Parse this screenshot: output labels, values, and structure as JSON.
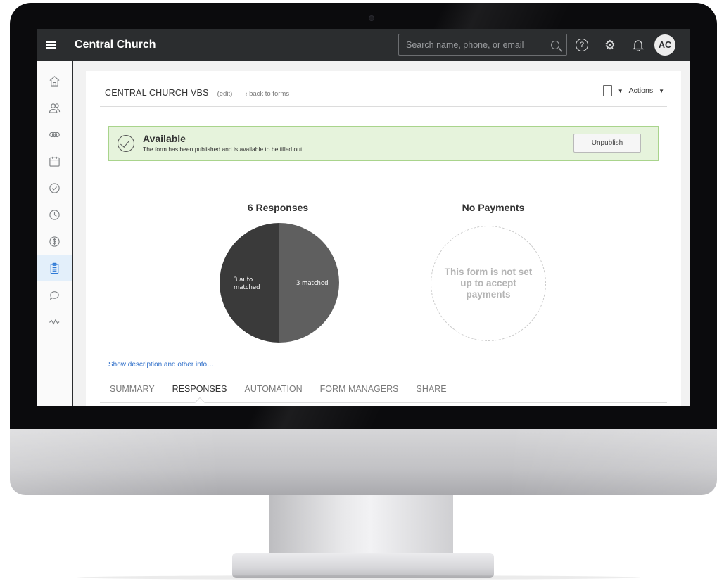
{
  "app": {
    "title": "Central Church"
  },
  "topbar": {
    "search_placeholder": "Search name, phone, or email",
    "avatar_initials": "AC"
  },
  "sidebar": {
    "items": [
      {
        "icon": "home-icon"
      },
      {
        "icon": "people-icon"
      },
      {
        "icon": "groups-icon"
      },
      {
        "icon": "calendar-icon"
      },
      {
        "icon": "check-circle-icon"
      },
      {
        "icon": "clock-icon"
      },
      {
        "icon": "dollar-icon"
      },
      {
        "icon": "clipboard-icon",
        "active": true
      },
      {
        "icon": "chat-icon"
      },
      {
        "icon": "activity-icon"
      }
    ]
  },
  "form_header": {
    "title": "CENTRAL CHURCH VBS",
    "edit_label": "(edit)",
    "back_label": "‹ back to forms",
    "actions_label": "Actions"
  },
  "status_banner": {
    "title": "Available",
    "subtitle": "The form has been published and is available to be filled out.",
    "button_label": "Unpublish"
  },
  "responses": {
    "title": "6 Responses",
    "slices": [
      {
        "label_line1": "3 auto",
        "label_line2": "matched",
        "value": 3,
        "color": "#3a3a3a"
      },
      {
        "label_line1": "3 matched",
        "label_line2": "",
        "value": 3,
        "color": "#5f5f5f"
      }
    ]
  },
  "payments": {
    "title": "No Payments",
    "message": "This form is not set up to accept payments"
  },
  "show_description_label": "Show description and other info…",
  "tabs": [
    {
      "label": "SUMMARY",
      "active": false
    },
    {
      "label": "RESPONSES",
      "active": true
    },
    {
      "label": "AUTOMATION",
      "active": false
    },
    {
      "label": "FORM MANAGERS",
      "active": false
    },
    {
      "label": "SHARE",
      "active": false
    }
  ]
}
